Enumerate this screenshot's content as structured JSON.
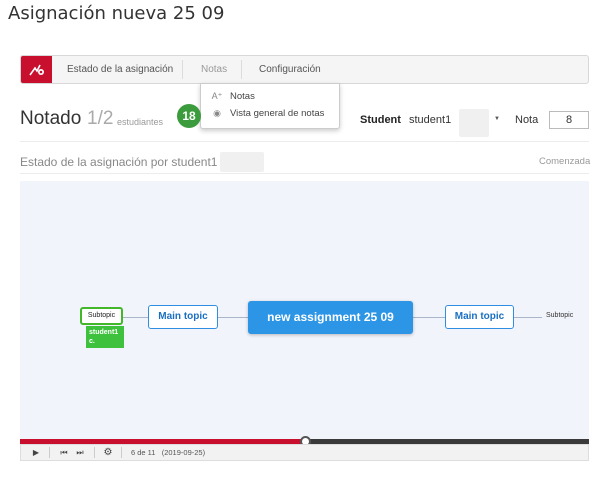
{
  "page_title": "Asignación nueva 25 09",
  "toolbar": {
    "logo_icon": "red-app-logo",
    "tabs": [
      {
        "label": "Estado de la asignación"
      },
      {
        "label": "Notas"
      },
      {
        "label": "Configuración"
      }
    ]
  },
  "dropdown": {
    "items": [
      {
        "icon": "A⁺",
        "icon_name": "grade-letter-icon",
        "label": "Notas"
      },
      {
        "icon": "◉",
        "icon_name": "eye-icon",
        "label": "Vista general de notas"
      }
    ]
  },
  "badge": "18",
  "grading": {
    "title": "Notado",
    "count": "1/2",
    "count_suffix": "estudiantes"
  },
  "student": {
    "label": "Student",
    "selected": "student1"
  },
  "grade": {
    "label": "Nota",
    "value": "8"
  },
  "status": {
    "title": "Estado de la asignación por student1",
    "value": "Comenzada"
  },
  "mindmap": {
    "central": "new assignment 25 09",
    "left_main": "Main topic",
    "right_main": "Main topic",
    "left_subtopic": "Subtopic",
    "right_subtopic": "Subtopic",
    "student_tag": "student1 c."
  },
  "player": {
    "progress_fraction": 0.5,
    "frame_info": "6 de 11   (2019-09-25)"
  },
  "colors": {
    "accent_red": "#c8102e",
    "badge_green": "#3c9b3c",
    "node_blue": "#2c95e6"
  }
}
